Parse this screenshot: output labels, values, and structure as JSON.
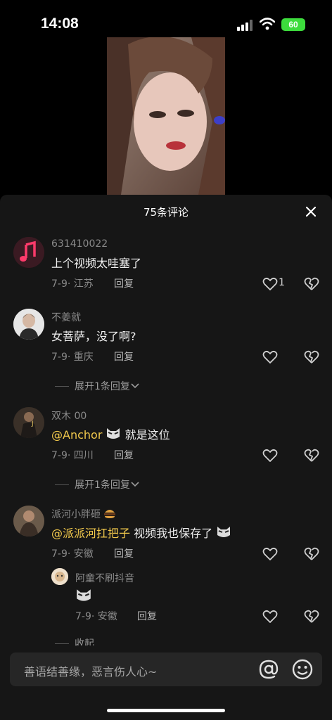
{
  "status": {
    "time": "14:08",
    "battery": "60"
  },
  "panel": {
    "title": "75条评论"
  },
  "comments": [
    {
      "user": "631410022",
      "text": "上个视频太哇塞了",
      "date": "7-9",
      "location": "江苏",
      "reply": "回复",
      "likes": "1"
    },
    {
      "user": "不姜就",
      "text": "女菩萨，没了啊?",
      "date": "7-9",
      "location": "重庆",
      "reply": "回复",
      "expand": "展开1条回复"
    },
    {
      "user": "双木 00",
      "mention": "@Anchor",
      "text": "就是这位",
      "date": "7-9",
      "location": "四川",
      "reply": "回复",
      "expand": "展开1条回复"
    },
    {
      "user": "派河小胖砸",
      "mention": "@派派河扛把子",
      "text": " 视频我也保存了",
      "date": "7-9",
      "location": "安徽",
      "reply": "回复"
    }
  ],
  "subreply": {
    "user": "阿童不刷抖音",
    "date": "7-9",
    "location": "安徽",
    "reply": "回复"
  },
  "collapse": "收起",
  "input": {
    "placeholder": "善语结善缘，恶言伤人心~"
  },
  "colors": {
    "mention": "#f2c94c",
    "battery": "#3ddc3d",
    "panel_bg": "#161616"
  }
}
